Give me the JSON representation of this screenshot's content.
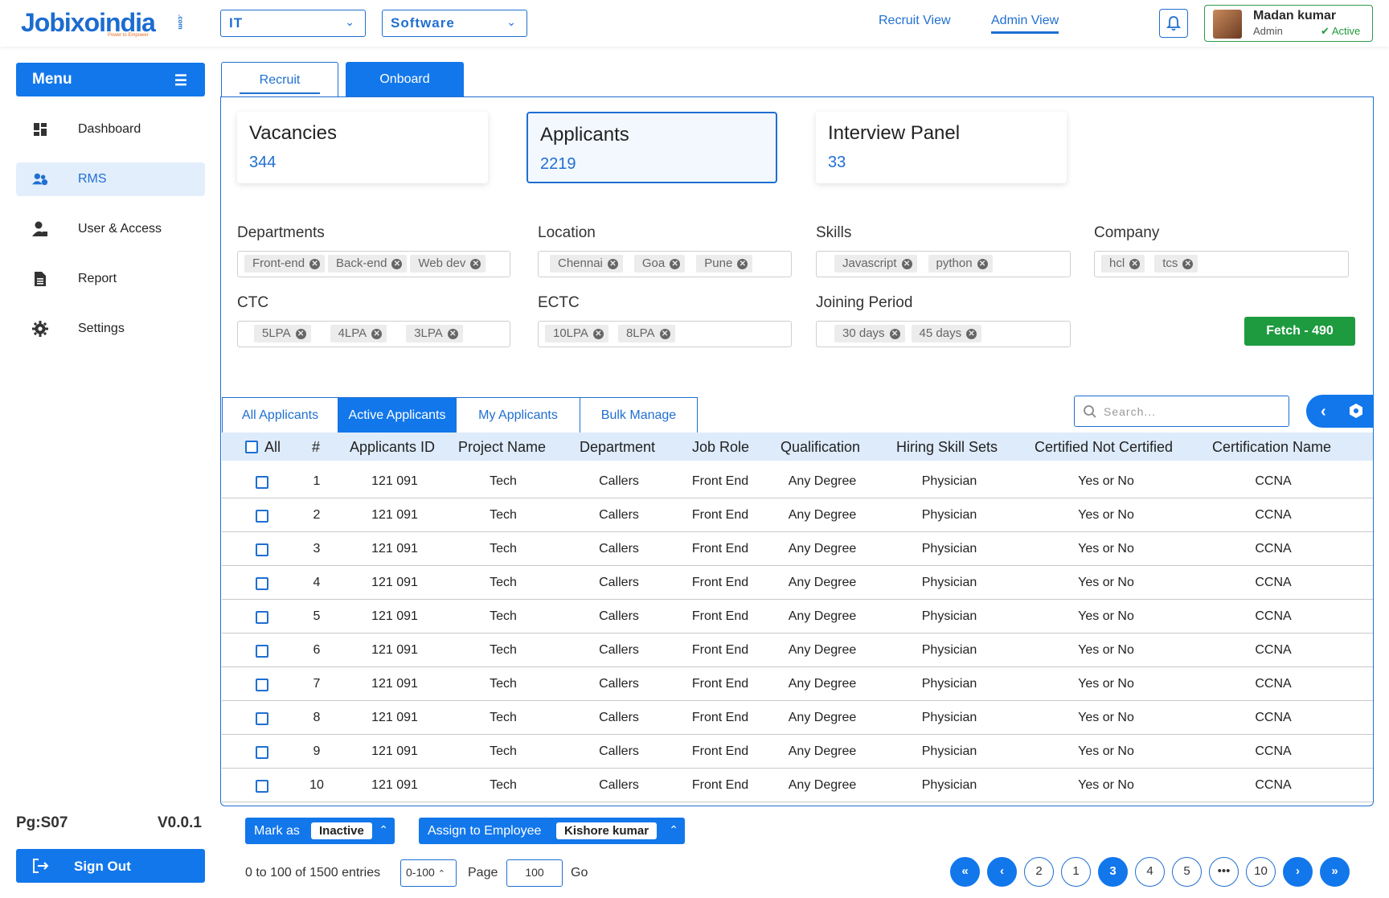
{
  "brand": {
    "logo_main": "Jobixo",
    "logo_india": "india",
    "logo_tagline": "Power to Empower",
    "logo_com": ".com"
  },
  "header": {
    "category_select": "IT",
    "subcategory_select": "Software",
    "recruit_view": "Recruit View",
    "admin_view": "Admin View",
    "user": {
      "name": "Madan kumar",
      "role": "Admin",
      "status": "Active"
    }
  },
  "sidebar": {
    "menu_label": "Menu",
    "items": [
      {
        "label": "Dashboard",
        "icon": "dashboard-icon"
      },
      {
        "label": "RMS",
        "icon": "users-icon"
      },
      {
        "label": "User & Access",
        "icon": "user-lock-icon"
      },
      {
        "label": "Report",
        "icon": "document-icon"
      },
      {
        "label": "Settings",
        "icon": "gear-icon"
      }
    ],
    "page_code": "Pg:S07",
    "version": "V0.0.1",
    "sign_out": "Sign Out"
  },
  "main_tabs": {
    "recruit": "Recruit",
    "onboard": "Onboard"
  },
  "stats": [
    {
      "title": "Vacancies",
      "value": "344"
    },
    {
      "title": "Applicants",
      "value": "2219"
    },
    {
      "title": "Interview Panel",
      "value": "33"
    }
  ],
  "filters": {
    "departments": {
      "label": "Departments",
      "chips": [
        "Front-end",
        "Back-end",
        "Web dev"
      ]
    },
    "location": {
      "label": "Location",
      "chips": [
        "Chennai",
        "Goa",
        "Pune"
      ]
    },
    "skills": {
      "label": "Skills",
      "chips": [
        "Javascript",
        "python"
      ]
    },
    "company": {
      "label": "Company",
      "chips": [
        "hcl",
        "tcs"
      ]
    },
    "ctc": {
      "label": "CTC",
      "chips": [
        "5LPA",
        "4LPA",
        "3LPA"
      ]
    },
    "ectc": {
      "label": "ECTC",
      "chips": [
        "10LPA",
        "8LPA"
      ]
    },
    "joining": {
      "label": "Joining Period",
      "chips": [
        "30 days",
        "45 days"
      ]
    },
    "fetch_button": "Fetch - 490"
  },
  "applicant_tabs": [
    "All Applicants",
    "Active Applicants",
    "My Applicants",
    "Bulk Manage"
  ],
  "search": {
    "placeholder": "Search..."
  },
  "table": {
    "columns": [
      "All",
      "#",
      "Applicants ID",
      "Project Name",
      "Department",
      "Job Role",
      "Qualification",
      "Hiring Skill Sets",
      "Certified Not Certified",
      "Certification Name"
    ],
    "rows": [
      [
        "1",
        "121 091",
        "Tech",
        "Callers",
        "Front End",
        "Any Degree",
        "Physician",
        "Yes or No",
        "CCNA"
      ],
      [
        "2",
        "121 091",
        "Tech",
        "Callers",
        "Front End",
        "Any Degree",
        "Physician",
        "Yes or No",
        "CCNA"
      ],
      [
        "3",
        "121 091",
        "Tech",
        "Callers",
        "Front End",
        "Any Degree",
        "Physician",
        "Yes or No",
        "CCNA"
      ],
      [
        "4",
        "121 091",
        "Tech",
        "Callers",
        "Front End",
        "Any Degree",
        "Physician",
        "Yes or No",
        "CCNA"
      ],
      [
        "5",
        "121 091",
        "Tech",
        "Callers",
        "Front End",
        "Any Degree",
        "Physician",
        "Yes or No",
        "CCNA"
      ],
      [
        "6",
        "121 091",
        "Tech",
        "Callers",
        "Front End",
        "Any Degree",
        "Physician",
        "Yes or No",
        "CCNA"
      ],
      [
        "7",
        "121 091",
        "Tech",
        "Callers",
        "Front End",
        "Any Degree",
        "Physician",
        "Yes or No",
        "CCNA"
      ],
      [
        "8",
        "121 091",
        "Tech",
        "Callers",
        "Front End",
        "Any Degree",
        "Physician",
        "Yes or No",
        "CCNA"
      ],
      [
        "9",
        "121 091",
        "Tech",
        "Callers",
        "Front End",
        "Any Degree",
        "Physician",
        "Yes or No",
        "CCNA"
      ],
      [
        "10",
        "121 091",
        "Tech",
        "Callers",
        "Front End",
        "Any Degree",
        "Physician",
        "Yes or No",
        "CCNA"
      ]
    ]
  },
  "bulk_actions": {
    "mark_as_label": "Mark as",
    "mark_as_value": "Inactive",
    "assign_label": "Assign to Employee",
    "assign_value": "Kishore kumar"
  },
  "pagination": {
    "entries_text": "0 to 100 of 1500 entries",
    "range": "0-100",
    "page_label": "Page",
    "page_value": "100",
    "go_label": "Go",
    "pages": [
      "«",
      "‹",
      "2",
      "1",
      "3",
      "4",
      "5",
      "•••",
      "10",
      "›",
      "»"
    ],
    "current_page": "3"
  },
  "colors": {
    "primary": "#1277eb",
    "success": "#1e9a3f",
    "header_row": "#deebfb",
    "accent_orange": "#f7931e"
  }
}
